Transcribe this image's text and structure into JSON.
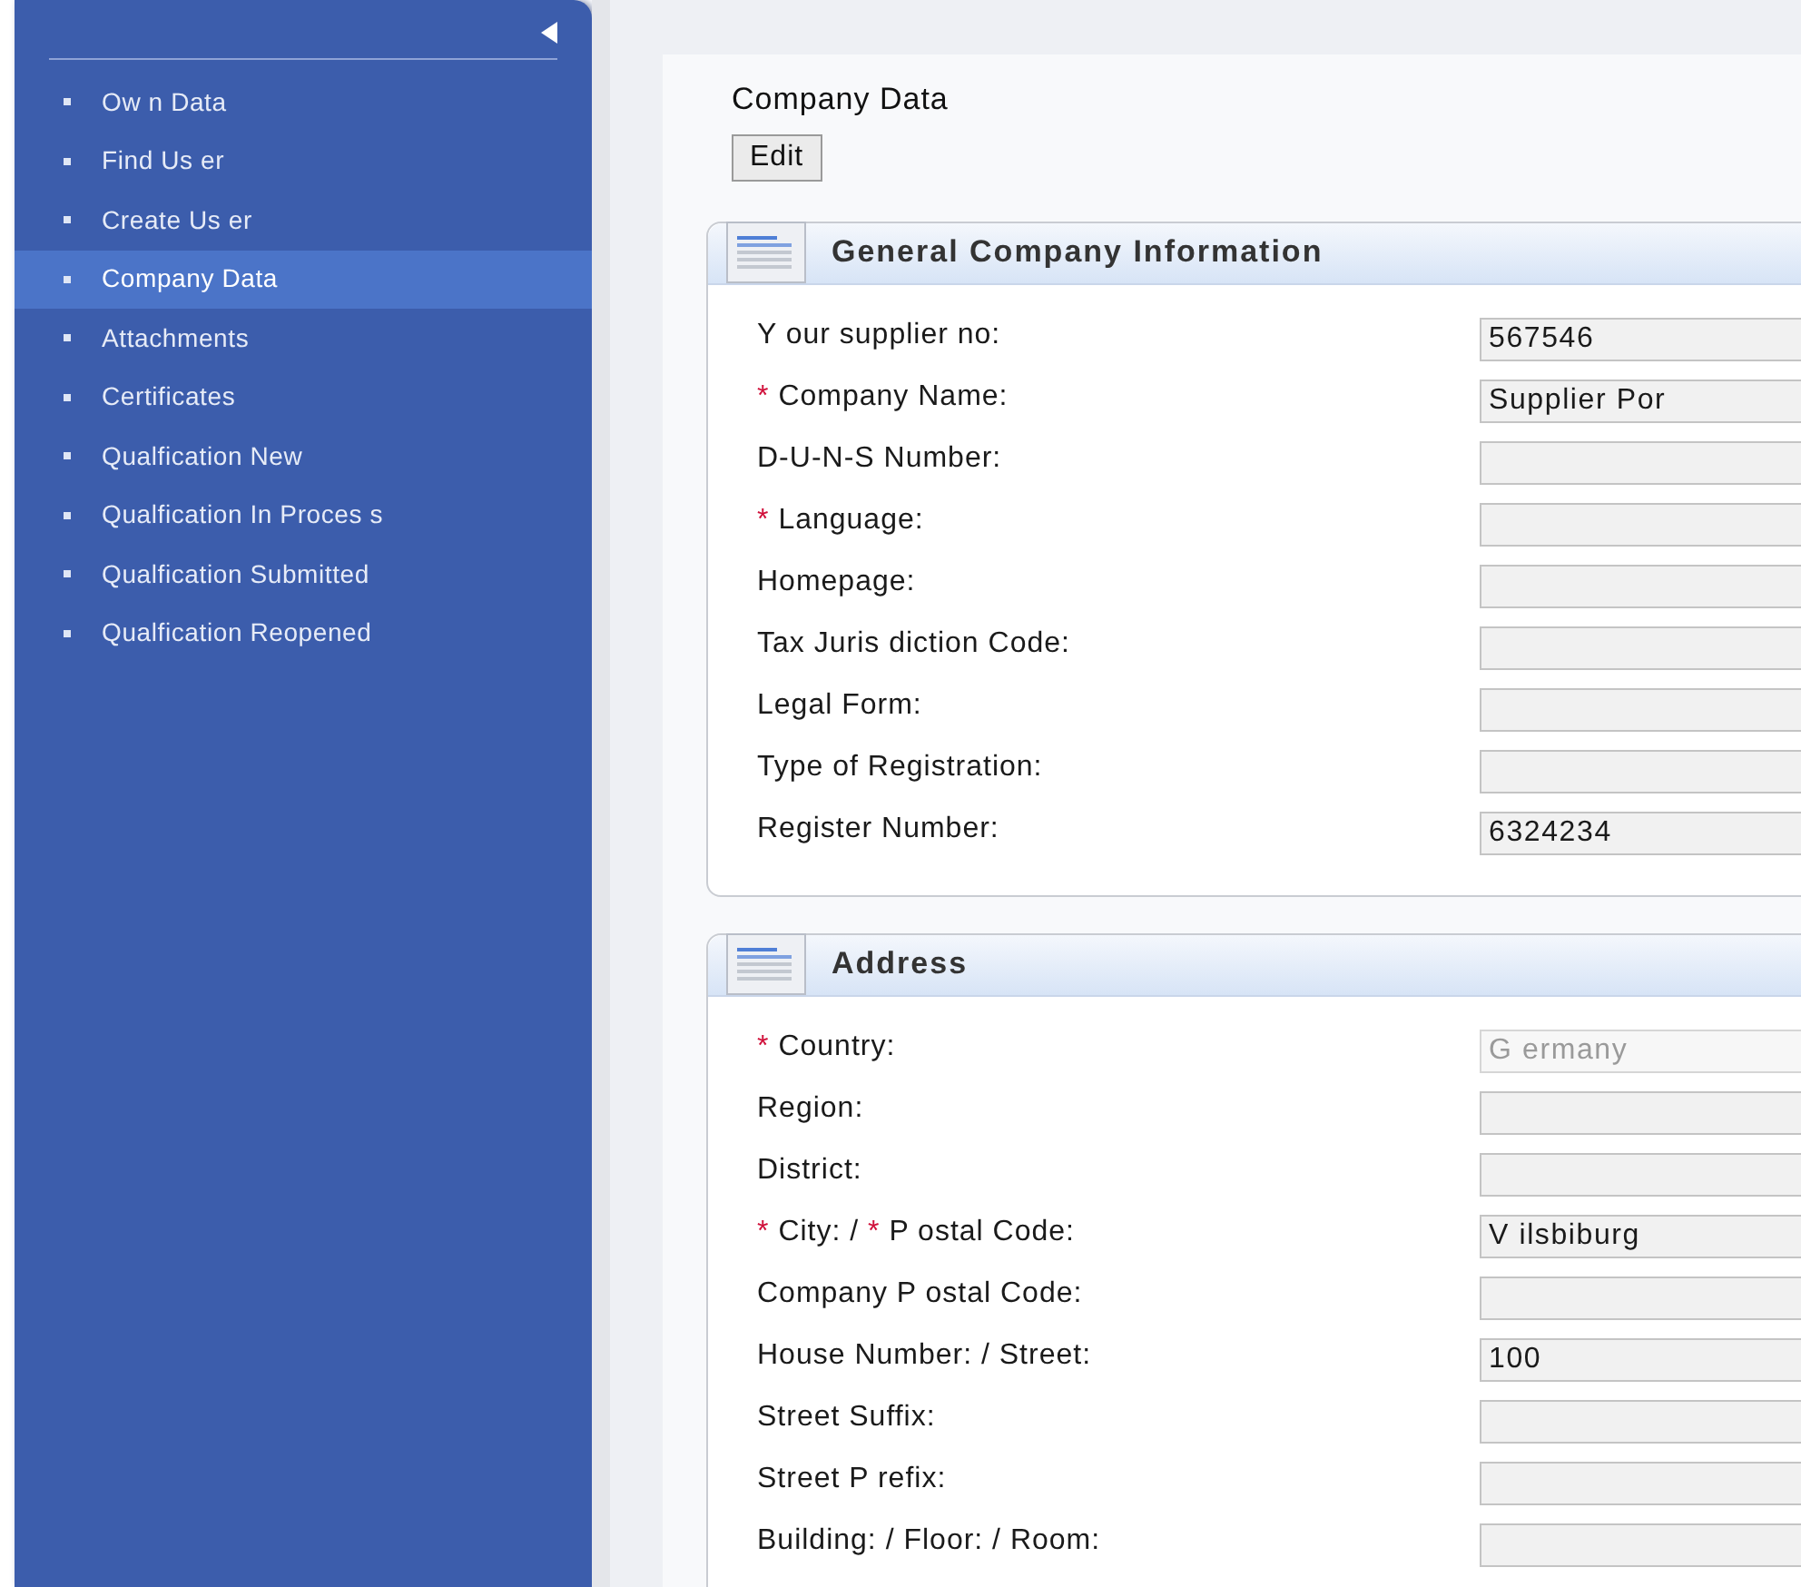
{
  "sidebar": {
    "items": [
      {
        "label": "Ow n Data",
        "selected": false
      },
      {
        "label": "Find Us er",
        "selected": false
      },
      {
        "label": "Create Us er",
        "selected": false
      },
      {
        "label": "Company Data",
        "selected": true
      },
      {
        "label": "Attachments",
        "selected": false
      },
      {
        "label": "Certificates",
        "selected": false
      },
      {
        "label": "Qualfication New",
        "selected": false
      },
      {
        "label": "Qualfication In Proces s",
        "selected": false
      },
      {
        "label": "Qualfication Submitted",
        "selected": false
      },
      {
        "label": "Qualfication Reopened",
        "selected": false
      }
    ]
  },
  "page": {
    "title": "Company Data",
    "edit_button": "Edit"
  },
  "sections": [
    {
      "title": "General Company Information",
      "fields": [
        {
          "label": [
            {
              "kind": "text",
              "text": "Y our supplier no:"
            }
          ],
          "value": "567546",
          "disabled": false
        },
        {
          "label": [
            {
              "kind": "mark",
              "text": "*"
            },
            {
              "kind": "text",
              "text": "Company  Name:"
            }
          ],
          "value": "Supplier Por",
          "disabled": false
        },
        {
          "label": [
            {
              "kind": "text",
              "text": "D-U-N-S Number:"
            }
          ],
          "disabled": false
        },
        {
          "label": [
            {
              "kind": "mark",
              "text": "*"
            },
            {
              "kind": "text",
              "text": "Language:"
            }
          ],
          "disabled": false
        },
        {
          "label": [
            {
              "kind": "text",
              "text": "Homepage:"
            }
          ],
          "disabled": false
        },
        {
          "label": [
            {
              "kind": "text",
              "text": "Tax Juris diction Code:"
            }
          ],
          "disabled": false
        },
        {
          "label": [
            {
              "kind": "text",
              "text": "Legal Form:"
            }
          ],
          "disabled": false
        },
        {
          "label": [
            {
              "kind": "text",
              "text": "Type  of Registration:"
            }
          ],
          "disabled": false
        },
        {
          "label": [
            {
              "kind": "text",
              "text": "Register Number:"
            }
          ],
          "value": "6324234",
          "disabled": false
        }
      ]
    },
    {
      "title": "Address",
      "fields": [
        {
          "label": [
            {
              "kind": "mark",
              "text": "*"
            },
            {
              "kind": "text",
              "text": "Country:"
            }
          ],
          "value": "G ermany",
          "disabled": true
        },
        {
          "label": [
            {
              "kind": "text",
              "text": "Region:"
            }
          ],
          "disabled": false
        },
        {
          "label": [
            {
              "kind": "text",
              "text": "District:"
            }
          ],
          "disabled": false
        },
        {
          "label": [
            {
              "kind": "mark",
              "text": "*"
            },
            {
              "kind": "text",
              "text": "City: /"
            },
            {
              "kind": "mark",
              "text": "*"
            },
            {
              "kind": "text",
              "text": "P ostal Code:"
            }
          ],
          "value": "V ilsbiburg",
          "disabled": false
        },
        {
          "label": [
            {
              "kind": "text",
              "text": "Company  P ostal Code:"
            }
          ],
          "disabled": false
        },
        {
          "label": [
            {
              "kind": "text",
              "text": "House Number: / Street:"
            }
          ],
          "value": "100",
          "disabled": false
        },
        {
          "label": [
            {
              "kind": "text",
              "text": "Street Suffix:"
            }
          ],
          "disabled": false
        },
        {
          "label": [
            {
              "kind": "text",
              "text": "Street P refix:"
            }
          ],
          "disabled": false
        },
        {
          "label": [
            {
              "kind": "text",
              "text": "Building: / Floor: / Room:"
            }
          ],
          "disabled": false
        }
      ]
    }
  ]
}
